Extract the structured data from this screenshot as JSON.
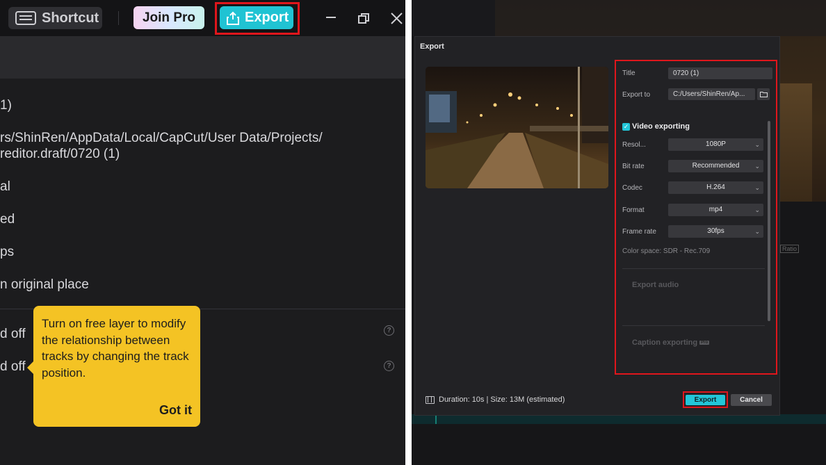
{
  "left_panel": {
    "topbar": {
      "shortcut_label": "Shortcut",
      "shortcut_icon": "keyboard-icon",
      "join_pro_label": "Join Pro",
      "export_label": "Export",
      "export_icon": "upload-icon",
      "minimize_icon": "minimize-icon",
      "restore_icon": "restore-icon",
      "close_icon": "close-icon"
    },
    "info_lines": [
      "1)",
      "rs/ShinRen/AppData/Local/CapCut/User Data/Projects/",
      "reditor.draft/0720 (1)",
      "al",
      "ed",
      "ps",
      "n original place"
    ],
    "toggle_rows": [
      "d off",
      "d off"
    ],
    "tooltip": {
      "text": "Turn on free layer to modify the relationship between tracks by changing the track position.",
      "button": "Got it",
      "color": "#f4c324"
    }
  },
  "export_dialog": {
    "title": "Export",
    "settings": {
      "title_label": "Title",
      "title_value": "0720 (1)",
      "export_to_label": "Export to",
      "export_to_value": "C:/Users/ShinRen/Ap...",
      "video_section": "Video exporting",
      "video_checked": true,
      "rows": [
        {
          "label": "Resol...",
          "value": "1080P"
        },
        {
          "label": "Bit rate",
          "value": "Recommended"
        },
        {
          "label": "Codec",
          "value": "H.264"
        },
        {
          "label": "Format",
          "value": "mp4"
        },
        {
          "label": "Frame rate",
          "value": "30fps"
        }
      ],
      "color_space": "Color space: SDR - Rec.709",
      "audio_section": "Export audio",
      "caption_section": "Caption exporting",
      "caption_badge": "Pro"
    },
    "footer": {
      "duration_text": "Duration: 10s | Size: 13M (estimated)",
      "export_button": "Export",
      "cancel_button": "Cancel"
    },
    "accent_color": "#22c6d8",
    "highlight_color": "#e0161c"
  },
  "preview_misc": {
    "ratio_label": "Ratio"
  }
}
